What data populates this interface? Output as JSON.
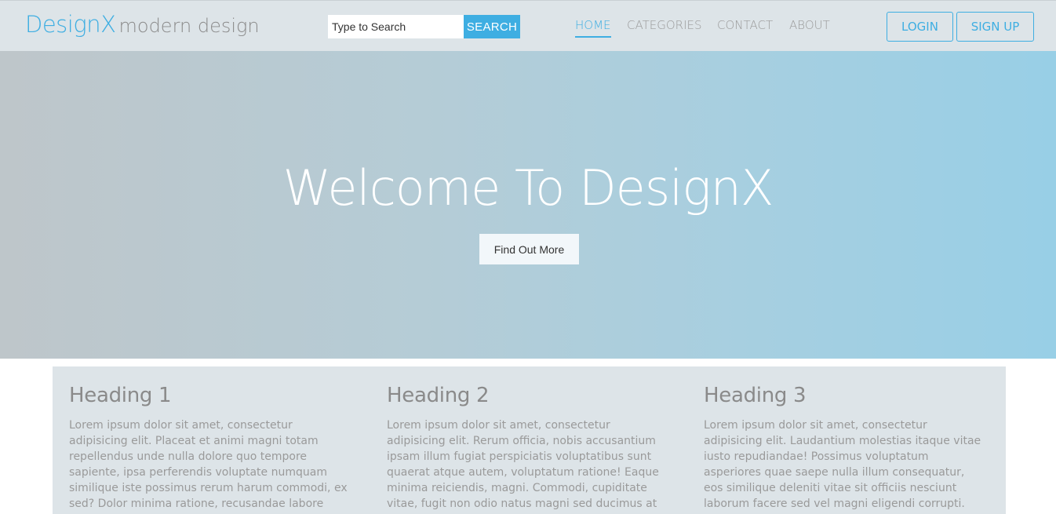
{
  "header": {
    "brand_name": "DesignX",
    "brand_tagline": "modern design",
    "search": {
      "placeholder": "Type to Search",
      "button_label": "SEARCH"
    },
    "nav": {
      "home": "HOME",
      "categories": "CATEGORIES",
      "contact": "CONTACT",
      "about": "ABOUT",
      "active": "HOME"
    },
    "login_label": "LOGIN",
    "signup_label": "SIGN UP"
  },
  "hero": {
    "title": "Welcome To DesignX",
    "button_label": "Find Out More"
  },
  "columns": [
    {
      "heading": "Heading 1",
      "text": "Lorem ipsum dolor sit amet, consectetur adipisicing elit. Placeat et animi magni totam repellendus unde nulla dolore quo tempore sapiente, ipsa perferendis voluptate numquam similique iste possimus rerum harum commodi, ex sed? Dolor minima ratione, recusandae labore"
    },
    {
      "heading": "Heading 2",
      "text": "Lorem ipsum dolor sit amet, consectetur adipisicing elit. Rerum officia, nobis accusantium ipsam illum fugiat perspiciatis voluptatibus sunt quaerat atque autem, voluptatum ratione! Eaque minima reiciendis, magni. Commodi, cupiditate vitae, fugit non odio natus magni sed ducimus at"
    },
    {
      "heading": "Heading 3",
      "text": "Lorem ipsum dolor sit amet, consectetur adipisicing elit. Laudantium molestias itaque vitae iusto repudiandae! Possimus voluptatum asperiores quae saepe nulla illum consequatur, eos similique deleniti vitae sit officiis nesciunt laborum facere sed vel magni eligendi corrupti. Fuga, magni,"
    }
  ],
  "colors": {
    "accent": "#3eaee2",
    "navbar_bg": "#dde4e8",
    "hero_gradient_start": "#bec6ca",
    "hero_gradient_end": "#98cfe6"
  }
}
